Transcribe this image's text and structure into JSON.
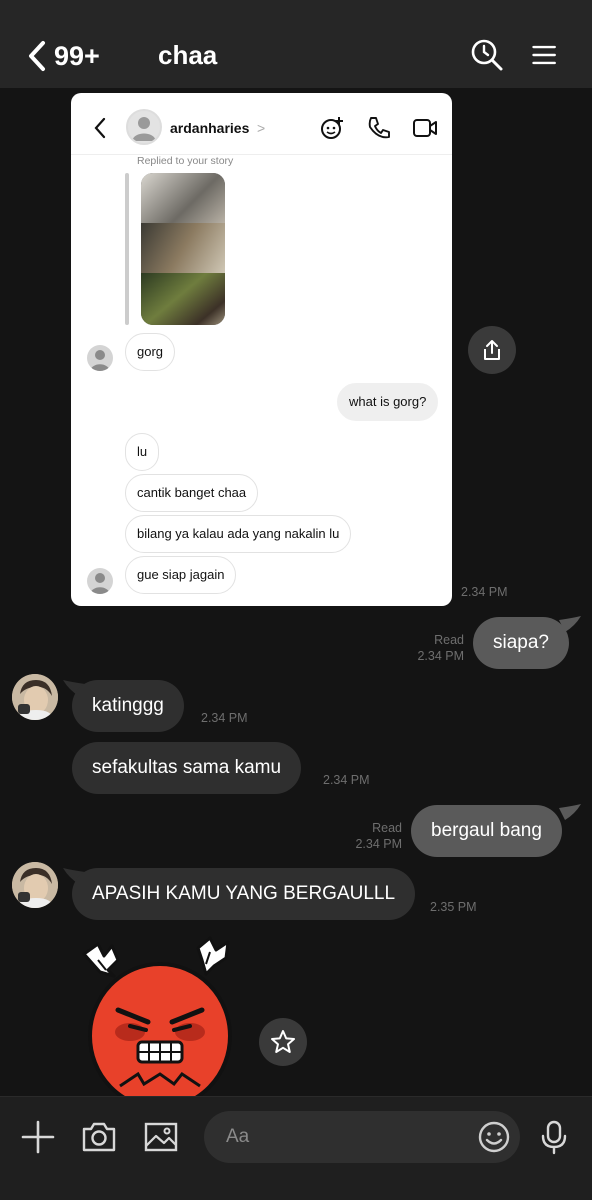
{
  "header": {
    "unread_count": "99+",
    "title": "chaa"
  },
  "shared_screenshot": {
    "username": "ardanharies",
    "chevron": ">",
    "replied_label": "Replied to your story",
    "messages": [
      {
        "text": "gorg",
        "from": "them"
      },
      {
        "text": "what is gorg?",
        "from": "me"
      },
      {
        "text": "lu",
        "from": "them"
      },
      {
        "text": "cantik banget chaa",
        "from": "them"
      },
      {
        "text": "bilang ya kalau ada yang nakalin lu",
        "from": "them"
      },
      {
        "text": "gue siap jagain",
        "from": "them"
      }
    ]
  },
  "chat": {
    "screenshot_time": "2.34 PM",
    "messages": [
      {
        "text": "siapa?",
        "from": "me",
        "read": "Read",
        "time": "2.34 PM"
      },
      {
        "text": "katinggg",
        "from": "them",
        "time": "2.34 PM"
      },
      {
        "text": "sefakultas sama kamu",
        "from": "them",
        "time": "2.34 PM"
      },
      {
        "text": "bergaul bang",
        "from": "me",
        "read": "Read",
        "time": "2.34 PM"
      },
      {
        "text": "APASIH KAMU YANG BERGAULLL",
        "from": "them",
        "time": "2.35 PM"
      }
    ],
    "sticker": "angry-red-face-sticker"
  },
  "composer": {
    "placeholder": "Aa"
  },
  "icons": {
    "back": "chevron-left-icon",
    "search": "search-clock-icon",
    "menu": "hamburger-menu-icon",
    "share": "share-icon",
    "favorite": "star-icon",
    "add": "plus-icon",
    "camera": "camera-icon",
    "gallery": "image-icon",
    "emoji": "smiley-icon",
    "mic": "microphone-icon"
  }
}
